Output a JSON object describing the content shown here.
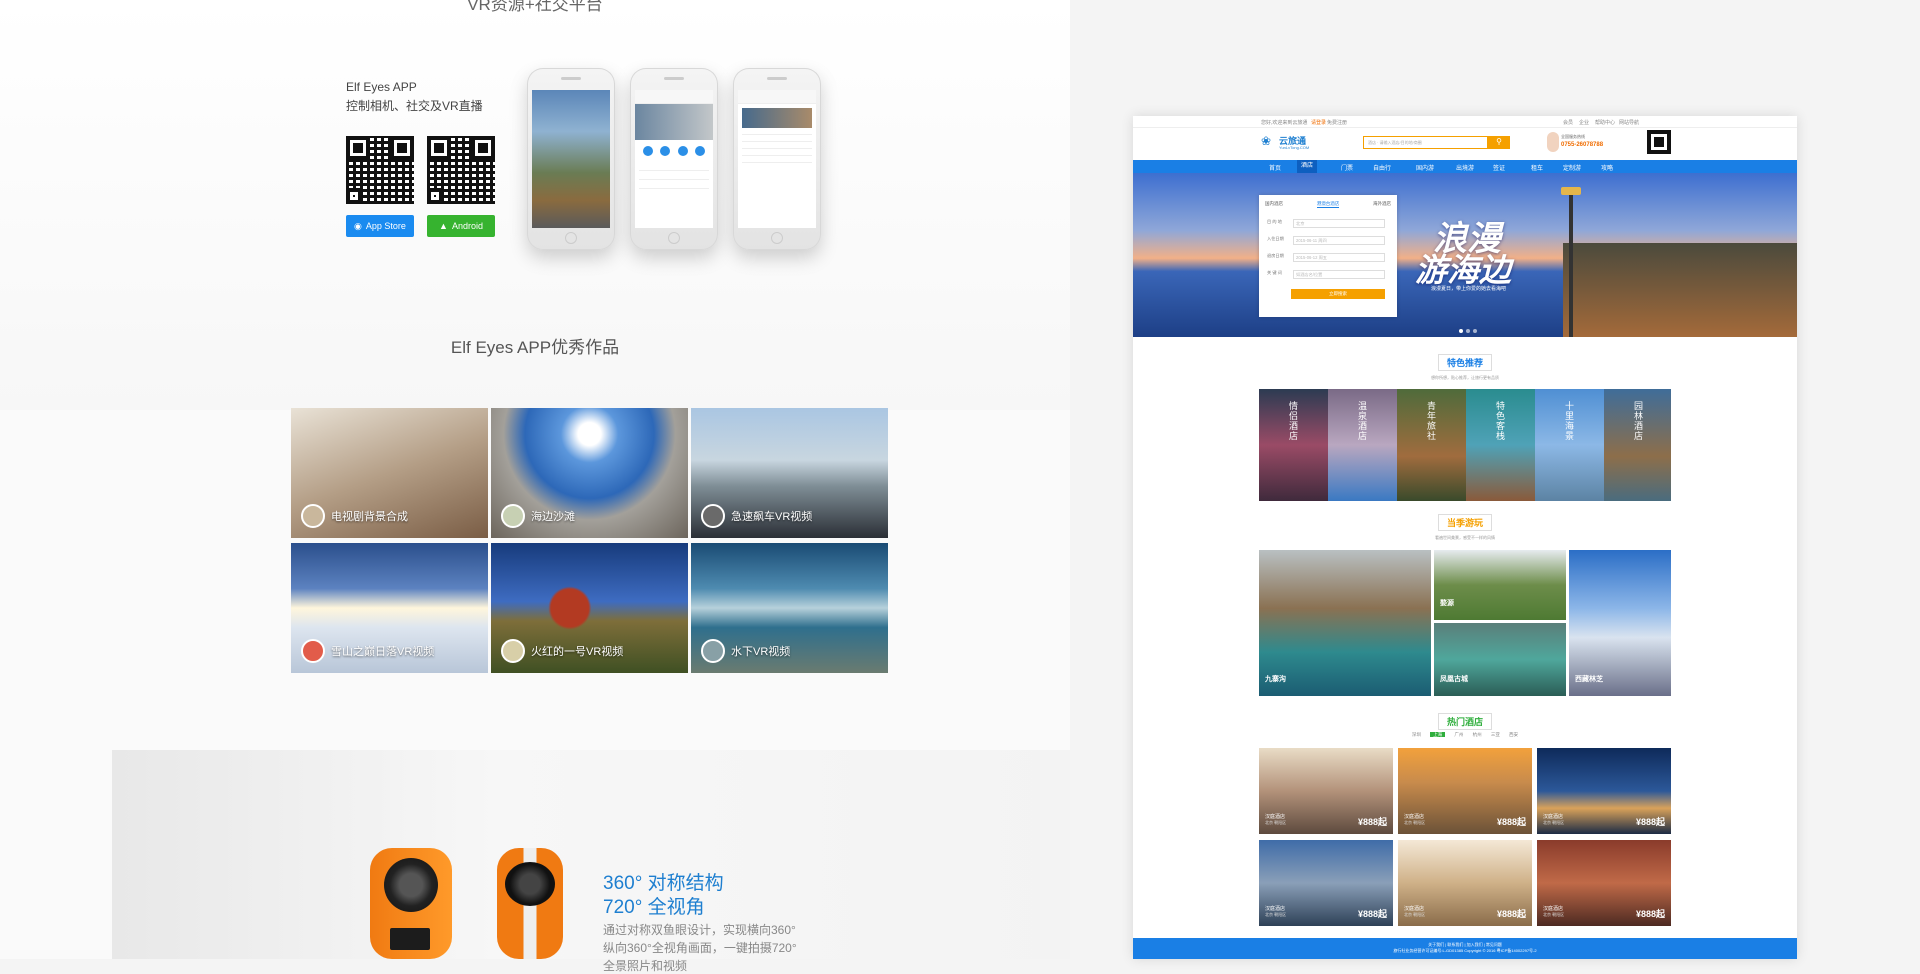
{
  "left": {
    "section_title": "VR资源+社交平台",
    "app": {
      "title": "Elf Eyes  APP",
      "subtitle": "控制相机、社交及VR直播",
      "appstore_label": "App Store",
      "android_label": "Android"
    },
    "works_title": "Elf Eyes APP优秀作品",
    "works": [
      {
        "caption": "电视剧背景合成"
      },
      {
        "caption": "海边沙滩"
      },
      {
        "caption": "急速飙车VR视频"
      },
      {
        "caption": "雪山之巅日落VR视频"
      },
      {
        "caption": "火红的一号VR视频"
      },
      {
        "caption": "水下VR视频"
      }
    ],
    "feature": {
      "line1": "360° 对称结构",
      "line2": "720° 全视角",
      "desc1": "通过对称双鱼眼设计，实现横向360°",
      "desc2": "纵向360°全视角画面，一键拍摄720°",
      "desc3": "全景照片和视频"
    }
  },
  "site": {
    "topbar": {
      "left": "您好,欢迎来到云旅通",
      "login": "请登录",
      "register": "免费注册",
      "right1": "会员",
      "right2": "企业",
      "right3": "帮助中心",
      "right4": "网站导航"
    },
    "logo": "云旅通",
    "logo_sub": "YunLvTong.COM",
    "search_placeholder": "酒店 · 请输入酒店/目的地/商圈",
    "phone_label": "全国服务热线",
    "phone": "0755-26078788",
    "nav": [
      "首页",
      "酒店",
      "门票",
      "自由行",
      "国内游",
      "出境游",
      "签证",
      "租车",
      "定制游",
      "攻略"
    ],
    "form": {
      "tabs": [
        "国内酒店",
        "港澳台酒店",
        "海外酒店"
      ],
      "rows": [
        {
          "label": "目 的 地",
          "value": "北京"
        },
        {
          "label": "入住日期",
          "value": "2015-06-11   周四"
        },
        {
          "label": "退房日期",
          "value": "2015-06-12   周五"
        },
        {
          "label": "关 键 词",
          "value": "如酒店名/位置"
        }
      ],
      "button": "立即搜索"
    },
    "banner": {
      "t1": "浪漫",
      "t2": "游海边",
      "t3": "浪漫夏日，带上你爱的她去看海吧"
    },
    "featured": {
      "title": "特色推荐",
      "desc": "想你所想，贴心推荐，让旅行更有品质",
      "items": [
        "情侣酒店",
        "温泉酒店",
        "青年旅社",
        "特色客栈",
        "十里海景",
        "园林酒店"
      ]
    },
    "season": {
      "title": "当季游玩",
      "desc": "看遍世间美景，感受不一样的风情",
      "items": [
        "九寨沟",
        "婺源",
        "凤凰古城",
        "西藏林芝"
      ]
    },
    "hot": {
      "title": "热门酒店",
      "cities": [
        "深圳",
        "上海",
        "广州",
        "杭州",
        "三亚",
        "西安"
      ],
      "active_city": "上海",
      "hotels": [
        {
          "name": "汉庭酒店",
          "loc": "北京 朝阳区",
          "price": "¥888起"
        },
        {
          "name": "汉庭酒店",
          "loc": "北京 朝阳区",
          "price": "¥888起"
        },
        {
          "name": "汉庭酒店",
          "loc": "北京 朝阳区",
          "price": "¥888起"
        },
        {
          "name": "汉庭酒店",
          "loc": "北京 朝阳区",
          "price": "¥888起"
        },
        {
          "name": "汉庭酒店",
          "loc": "北京 朝阳区",
          "price": "¥888起"
        },
        {
          "name": "汉庭酒店",
          "loc": "北京 朝阳区",
          "price": "¥888起"
        }
      ]
    },
    "footer": {
      "line1": "关于我们  |  联系我们  |  加入我们  |  常见问题",
      "line2": "旅行社业务经营许可证编号:L-GD01385    Copyright © 2016   粤ICP备14002297号-2"
    }
  }
}
